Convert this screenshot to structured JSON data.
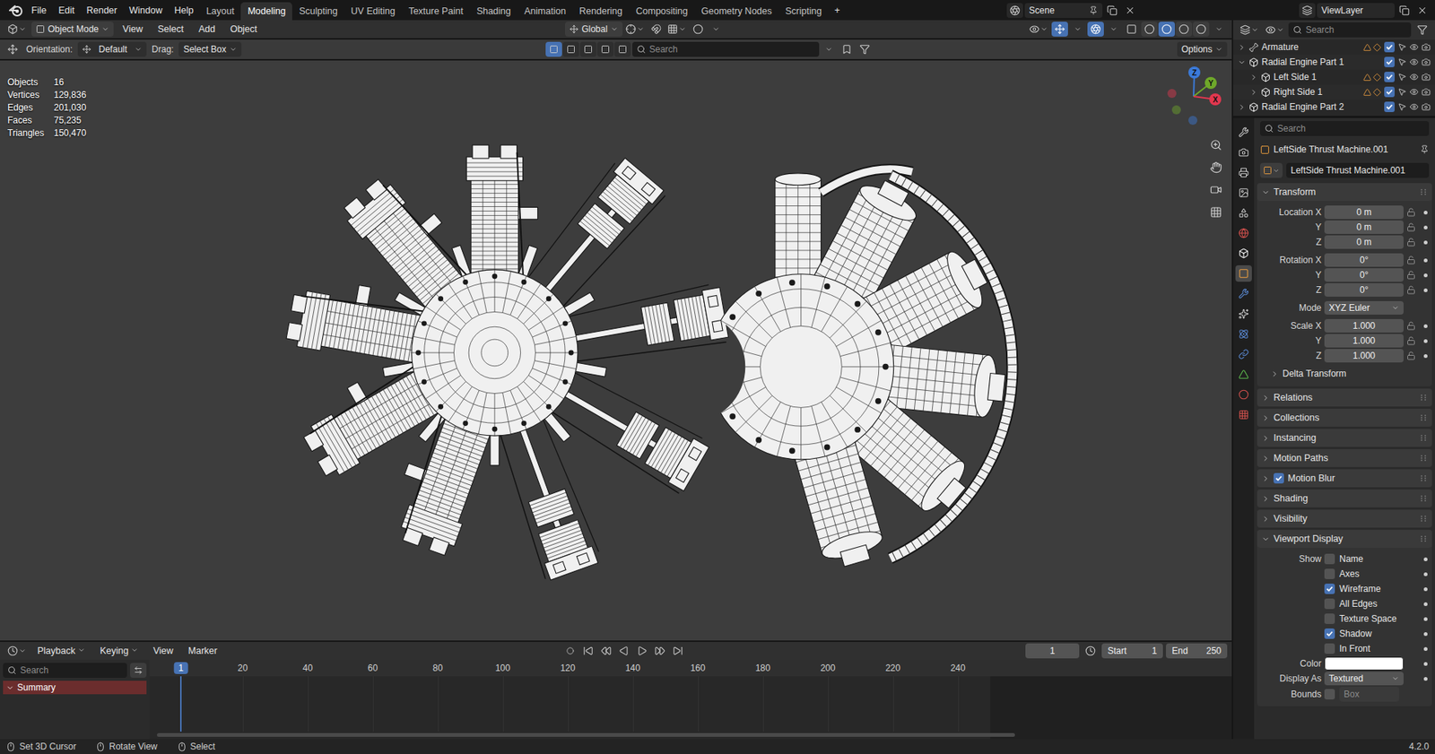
{
  "topbar": {
    "menus": [
      "File",
      "Edit",
      "Render",
      "Window",
      "Help"
    ],
    "workspaces": [
      {
        "label": "Layout",
        "selected": false
      },
      {
        "label": "Modeling",
        "selected": true
      },
      {
        "label": "Sculpting",
        "selected": false
      },
      {
        "label": "UV Editing",
        "selected": false
      },
      {
        "label": "Texture Paint",
        "selected": false
      },
      {
        "label": "Shading",
        "selected": false
      },
      {
        "label": "Animation",
        "selected": false
      },
      {
        "label": "Rendering",
        "selected": false
      },
      {
        "label": "Compositing",
        "selected": false
      },
      {
        "label": "Geometry Nodes",
        "selected": false
      },
      {
        "label": "Scripting",
        "selected": false
      }
    ],
    "add_workspace": "+",
    "scene": "Scene",
    "view_layer": "ViewLayer"
  },
  "viewport_header": {
    "mode": "Object Mode",
    "menus": [
      "View",
      "Select",
      "Add",
      "Object"
    ],
    "transform_orientation": "Global",
    "snap": false,
    "proportional_editing": false,
    "gizmos": true,
    "overlays": true,
    "xray": false,
    "shading_modes": [
      {
        "selected": false
      },
      {
        "selected": true
      },
      {
        "selected": false
      },
      {
        "selected": false
      }
    ]
  },
  "tool_header": {
    "orientation_label": "Orientation:",
    "orientation": "Default",
    "drag_label": "Drag:",
    "drag": "Select Box",
    "select_modes": [
      {
        "selected": true
      },
      {
        "selected": false
      },
      {
        "selected": false
      },
      {
        "selected": false
      },
      {
        "selected": false
      }
    ],
    "search_placeholder": "Search",
    "options": "Options"
  },
  "stats": [
    {
      "label": "Objects",
      "value": "16"
    },
    {
      "label": "Vertices",
      "value": "129,836"
    },
    {
      "label": "Edges",
      "value": "201,030"
    },
    {
      "label": "Faces",
      "value": "75,235"
    },
    {
      "label": "Triangles",
      "value": "150,470"
    }
  ],
  "gizmo": [
    {
      "label": "Z",
      "color": "#3b7ad9"
    },
    {
      "label": "Y",
      "color": "#6fa82a"
    },
    {
      "label": "X",
      "color": "#e2374f"
    }
  ],
  "outliner": {
    "search_placeholder": "Search",
    "items": [
      {
        "name": "Armature",
        "kind": "armature",
        "depth": 0,
        "expandable": true,
        "expanded": false,
        "checked": true,
        "has_contents": true
      },
      {
        "name": "Radial Engine Part 1",
        "kind": "collection",
        "depth": 0,
        "expandable": true,
        "expanded": true,
        "checked": true,
        "has_contents": false
      },
      {
        "name": "Left Side 1",
        "kind": "collection",
        "depth": 1,
        "expandable": true,
        "expanded": false,
        "checked": true,
        "has_contents": true
      },
      {
        "name": "Right Side 1",
        "kind": "collection",
        "depth": 1,
        "expandable": true,
        "expanded": false,
        "checked": true,
        "has_contents": true
      },
      {
        "name": "Radial Engine Part 2",
        "kind": "collection",
        "depth": 0,
        "expandable": true,
        "expanded": false,
        "checked": true,
        "has_contents": false
      }
    ]
  },
  "properties": {
    "search_placeholder": "Search",
    "context": "LeftSide Thrust Machine.001",
    "object_name": "LeftSide Thrust Machine.001",
    "tabs": [
      {
        "selected": false
      },
      {
        "selected": false
      },
      {
        "selected": false
      },
      {
        "selected": false
      },
      {
        "selected": false
      },
      {
        "selected": false
      },
      {
        "selected": false
      },
      {
        "selected": true
      },
      {
        "selected": false
      },
      {
        "selected": false
      },
      {
        "selected": false
      },
      {
        "selected": false
      },
      {
        "selected": false
      },
      {
        "selected": false
      },
      {
        "selected": false
      }
    ],
    "transform": {
      "title": "Transform",
      "expanded": true,
      "groups": [
        {
          "rows": [
            {
              "label": "Location X",
              "value": "0 m",
              "kind": "number",
              "locked": false
            },
            {
              "label": "Y",
              "value": "0 m",
              "kind": "number",
              "locked": false
            },
            {
              "label": "Z",
              "value": "0 m",
              "kind": "number",
              "locked": false
            }
          ]
        },
        {
          "rows": [
            {
              "label": "Rotation X",
              "value": "0°",
              "kind": "number",
              "locked": false
            },
            {
              "label": "Y",
              "value": "0°",
              "kind": "number",
              "locked": false
            },
            {
              "label": "Z",
              "value": "0°",
              "kind": "number",
              "locked": false
            }
          ]
        },
        {
          "rows": [
            {
              "label": "Mode",
              "value": "XYZ Euler",
              "kind": "dropdown",
              "locked": false
            }
          ]
        },
        {
          "rows": [
            {
              "label": "Scale X",
              "value": "1.000",
              "kind": "number",
              "locked": false
            },
            {
              "label": "Y",
              "value": "1.000",
              "kind": "number",
              "locked": false
            },
            {
              "label": "Z",
              "value": "1.000",
              "kind": "number",
              "locked": false
            }
          ]
        }
      ],
      "delta": {
        "title": "Delta Transform",
        "expanded": false
      }
    },
    "sections": [
      {
        "title": "Relations",
        "expanded": false,
        "kind": "plain",
        "checked": false
      },
      {
        "title": "Collections",
        "expanded": false,
        "kind": "plain",
        "checked": false
      },
      {
        "title": "Instancing",
        "expanded": false,
        "kind": "plain",
        "checked": false
      },
      {
        "title": "Motion Paths",
        "expanded": false,
        "kind": "plain",
        "checked": false
      },
      {
        "title": "Motion Blur",
        "expanded": false,
        "kind": "toggle",
        "checked": true
      },
      {
        "title": "Shading",
        "expanded": false,
        "kind": "plain",
        "checked": false
      },
      {
        "title": "Visibility",
        "expanded": false,
        "kind": "plain",
        "checked": false
      }
    ],
    "viewport_display": {
      "title": "Viewport Display",
      "expanded": true,
      "show_label": "Show",
      "show": [
        {
          "label": "Name",
          "checked": false
        },
        {
          "label": "Axes",
          "checked": false
        },
        {
          "label": "Wireframe",
          "checked": true
        },
        {
          "label": "All Edges",
          "checked": false
        },
        {
          "label": "Texture Space",
          "checked": false
        },
        {
          "label": "Shadow",
          "checked": true
        },
        {
          "label": "In Front",
          "checked": false
        }
      ],
      "color_label": "Color",
      "color": "#ffffff",
      "display_as_label": "Display As",
      "display_as": "Textured",
      "bounds_label": "Bounds",
      "bounds": false,
      "bounds_type": "Box",
      "bounds_type_disabled": true
    }
  },
  "timeline": {
    "menus": [
      {
        "label": "Playback",
        "dropdown": true
      },
      {
        "label": "Keying",
        "dropdown": true
      },
      {
        "label": "View",
        "dropdown": false
      },
      {
        "label": "Marker",
        "dropdown": false
      }
    ],
    "current_frame": "1",
    "start_label": "Start",
    "start": "1",
    "end_label": "End",
    "end": "250",
    "ruler": [
      {
        "label": "1",
        "selected": true
      },
      {
        "label": "20",
        "selected": false
      },
      {
        "label": "40",
        "selected": false
      },
      {
        "label": "60",
        "selected": false
      },
      {
        "label": "80",
        "selected": false
      },
      {
        "label": "100",
        "selected": false
      },
      {
        "label": "120",
        "selected": false
      },
      {
        "label": "140",
        "selected": false
      },
      {
        "label": "160",
        "selected": false
      },
      {
        "label": "180",
        "selected": false
      },
      {
        "label": "200",
        "selected": false
      },
      {
        "label": "220",
        "selected": false
      },
      {
        "label": "240",
        "selected": false
      }
    ],
    "search_placeholder": "Search",
    "channels": [
      {
        "name": "Summary",
        "expanded": true,
        "selected": true
      }
    ]
  },
  "status_bar": {
    "hints": [
      {
        "label": "Set 3D Cursor"
      },
      {
        "label": "Rotate View"
      },
      {
        "label": "Select"
      }
    ],
    "version": "4.2.0"
  }
}
